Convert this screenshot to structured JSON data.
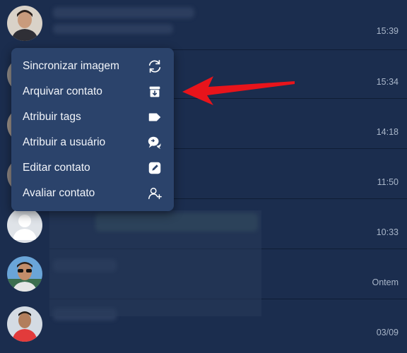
{
  "chats": [
    {
      "time": "15:39",
      "avatar": "photo-young-man"
    },
    {
      "time": "15:34",
      "avatar": "hidden"
    },
    {
      "time": "14:18",
      "avatar": "hidden"
    },
    {
      "time": "11:50",
      "avatar": "hidden"
    },
    {
      "time": "10:33",
      "avatar": "default-user"
    },
    {
      "time": "Ontem",
      "avatar": "photo-man-sunglasses"
    },
    {
      "time": "03/09",
      "avatar": "photo-man-red-shirt"
    }
  ],
  "context_menu": {
    "items": [
      {
        "label": "Sincronizar imagem",
        "icon": "sync-icon"
      },
      {
        "label": "Arquivar contato",
        "icon": "archive-icon"
      },
      {
        "label": "Atribuir tags",
        "icon": "tag-icon"
      },
      {
        "label": "Atribuir a usuário",
        "icon": "chat-transfer-icon"
      },
      {
        "label": "Editar contato",
        "icon": "edit-icon"
      },
      {
        "label": "Avaliar contato",
        "icon": "user-add-icon"
      }
    ]
  },
  "colors": {
    "background": "#1b2d4e",
    "menu_background": "#2b436b",
    "arrow": "#e8141b",
    "time_text": "#a9b6c9"
  }
}
